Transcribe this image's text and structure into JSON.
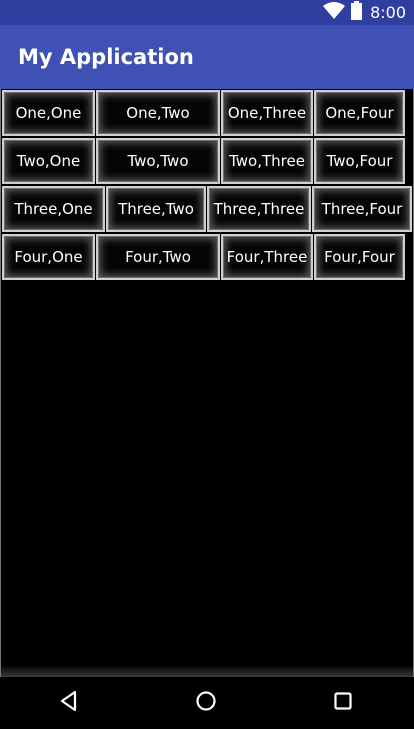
{
  "status_bar": {
    "time": "8:00",
    "icons": [
      "wifi-icon",
      "battery-icon"
    ]
  },
  "app_bar": {
    "title": "My Application",
    "color": "#3f51b5"
  },
  "table": {
    "rows": [
      [
        "One,One",
        "One,Two",
        "One,Three",
        "One,Four"
      ],
      [
        "Two,One",
        "Two,Two",
        "Two,Three",
        "Two,Four"
      ],
      [
        "Three,One",
        "Three,Two",
        "Three,Three",
        "Three,Four"
      ],
      [
        "Four,One",
        "Four,Two",
        "Four,Three",
        "Four,Four"
      ]
    ]
  },
  "nav_bar": {
    "buttons": [
      "back-icon",
      "home-icon",
      "recents-icon"
    ]
  }
}
